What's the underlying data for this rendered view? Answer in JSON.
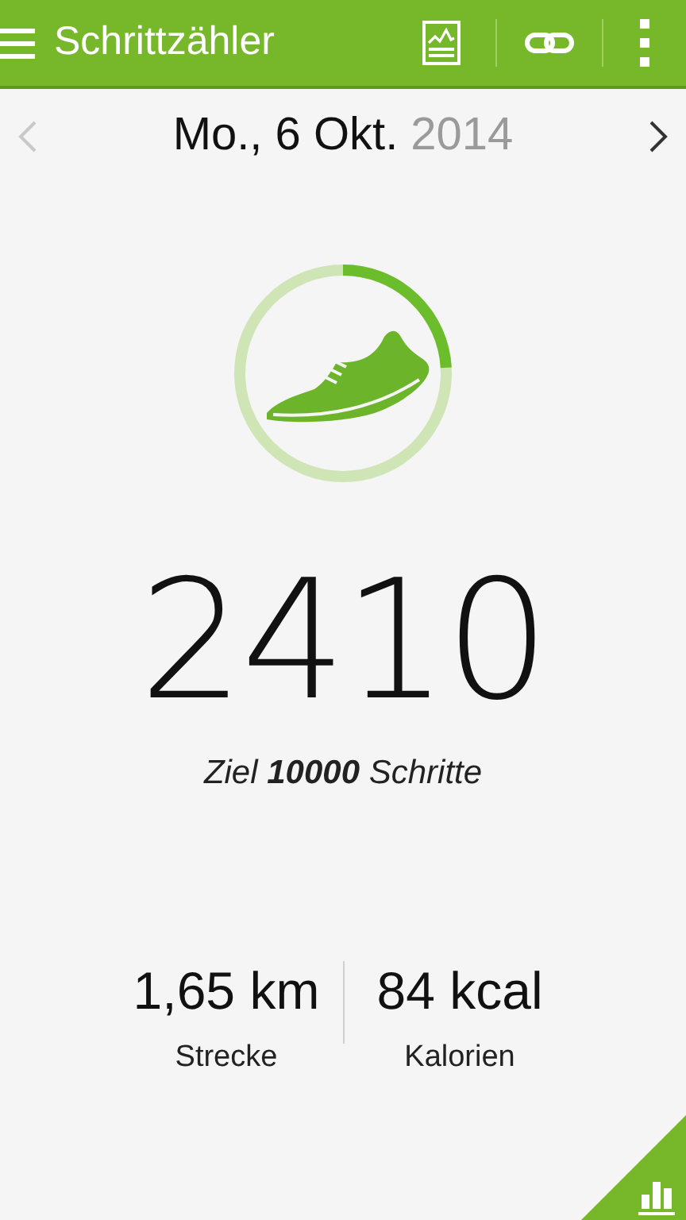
{
  "app_bar": {
    "title": "Schrittzähler"
  },
  "date": {
    "day": "Mo., 6 Okt.",
    "year": "2014"
  },
  "progress": {
    "level": 0.241
  },
  "steps": "2410",
  "goal": "Ziel **10000** Schritte",
  "stats": [
    {
      "value": "1,65 km",
      "label": "Strecke"
    },
    {
      "value": "84 kcal",
      "label": "Kalorien"
    }
  ]
}
